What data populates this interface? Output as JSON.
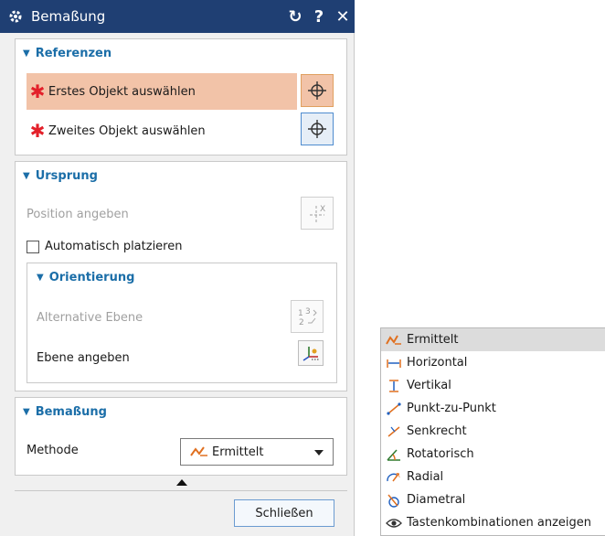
{
  "window": {
    "title": "Bemaßung",
    "reset_glyph": "↻",
    "help_glyph": "?",
    "close_glyph": "✕"
  },
  "sections": {
    "referenzen": {
      "title": "Referenzen",
      "first_object": "Erstes Objekt auswählen",
      "second_object": "Zweites Objekt auswählen"
    },
    "ursprung": {
      "title": "Ursprung",
      "position": "Position angeben",
      "auto_place": "Automatisch platzieren",
      "orientierung": {
        "title": "Orientierung",
        "alt_plane": "Alternative Ebene",
        "plane": "Ebene angeben"
      }
    },
    "bemassung": {
      "title": "Bemaßung",
      "method_label": "Methode",
      "method_value": "Ermittelt"
    }
  },
  "buttons": {
    "close": "Schließen"
  },
  "dropdown": {
    "items": [
      {
        "label": "Ermittelt",
        "icon": "inferred-icon",
        "selected": true
      },
      {
        "label": "Horizontal",
        "icon": "horizontal-icon"
      },
      {
        "label": "Vertikal",
        "icon": "vertical-icon"
      },
      {
        "label": "Punkt-zu-Punkt",
        "icon": "point-to-point-icon"
      },
      {
        "label": "Senkrecht",
        "icon": "perpendicular-icon"
      },
      {
        "label": "Rotatorisch",
        "icon": "rotational-icon"
      },
      {
        "label": "Radial",
        "icon": "radial-icon"
      },
      {
        "label": "Diametral",
        "icon": "diametral-icon"
      },
      {
        "label": "Tastenkombinationen anzeigen",
        "icon": "eye-icon"
      }
    ]
  },
  "colors": {
    "title_bar": "#1f3f73",
    "accent_text": "#1b6ea8",
    "required_star": "#e3202a",
    "active_row": "#f2c3a8"
  }
}
